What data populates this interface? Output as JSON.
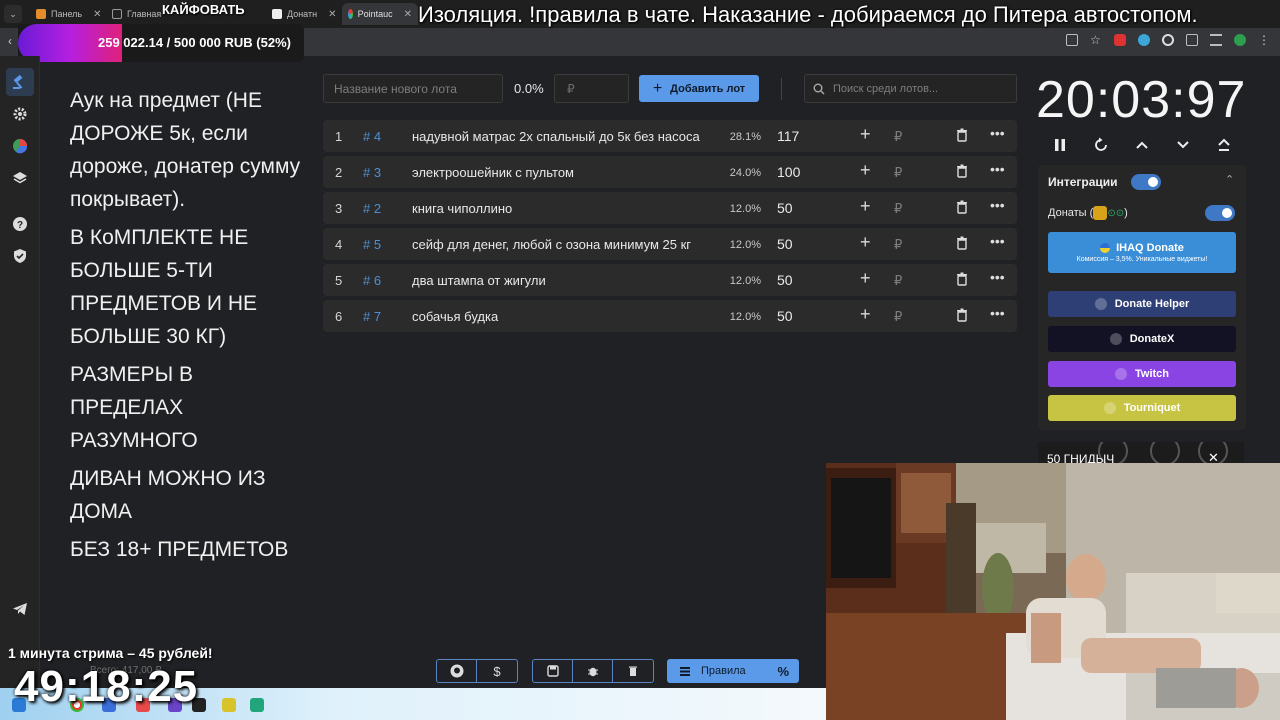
{
  "browser": {
    "tabs": [
      {
        "label": "Панель"
      },
      {
        "label": "Главная"
      },
      {
        "label": "Донатн"
      },
      {
        "label": "Pointauc"
      }
    ]
  },
  "overlay": {
    "stream_title": "Изоляция. !правила в чате. Наказание - добираемся до Питера автостопом.",
    "kaifovat": "КАЙФОВАТЬ",
    "donation_progress_text": "259 022.14 / 500 000 RUB (52%)",
    "donation_progress": 0.52,
    "stream_price_note": "1 минута стрима – 45 рублей!",
    "big_clock": "49:18:25",
    "total_faded": "Всего: 417,00 ₽"
  },
  "rules": [
    "Аук на предмет (НЕ ДОРОЖЕ 5к, если дороже, донатер сумму покрывает).",
    "В КоМПЛЕКТЕ НЕ БОЛЬШЕ 5-ТИ ПРЕДМЕТОВ И НЕ БОЛЬШЕ 30 КГ)",
    "РАЗМЕРЫ В ПРЕДЕЛАХ РАЗУМНОГО",
    "ДИВАН МОЖНО ИЗ ДОМА",
    "БЕЗ 18+ ПРЕДМЕТОВ"
  ],
  "lot_form": {
    "name_placeholder": "Название нового лота",
    "percent": "0.0%",
    "amount_placeholder": "₽",
    "add_label": "Добавить лот",
    "search_placeholder": "Поиск среди лотов..."
  },
  "lots": [
    {
      "n": "1",
      "id": "# 4",
      "name": "надувной матрас 2х спальный до 5к без насоса",
      "pct": "28.1%",
      "amount": "117",
      "rub": "₽"
    },
    {
      "n": "2",
      "id": "# 3",
      "name": "электроошейник с пультом",
      "pct": "24.0%",
      "amount": "100",
      "rub": "₽"
    },
    {
      "n": "3",
      "id": "# 2",
      "name": "книга чиполлино",
      "pct": "12.0%",
      "amount": "50",
      "rub": "₽"
    },
    {
      "n": "4",
      "id": "# 5",
      "name": "сейф для денег, любой с озона минимум 25 кг",
      "pct": "12.0%",
      "amount": "50",
      "rub": "₽"
    },
    {
      "n": "5",
      "id": "# 6",
      "name": "два штампа от жигули",
      "pct": "12.0%",
      "amount": "50",
      "rub": "₽"
    },
    {
      "n": "6",
      "id": "# 7",
      "name": "собачья будка",
      "pct": "12.0%",
      "amount": "50",
      "rub": "₽"
    }
  ],
  "timer": {
    "value": "20:03:97"
  },
  "integrations": {
    "title": "Интеграции",
    "donats_label": "Донаты (",
    "donats_close": ")",
    "iq_label": "IHAQ Donate",
    "iq_sub": "Комиссия – 3,5%. Уникальные виджеты!",
    "buttons": [
      {
        "label": "Donate Helper",
        "color": "#2d3f75"
      },
      {
        "label": "DonateX",
        "color": "#121224"
      },
      {
        "label": "Twitch",
        "color": "#8a44e4"
      },
      {
        "label": "Tourniquet",
        "color": "#c7c444"
      }
    ]
  },
  "pic_strip_text": "50 ГНИДЫЧ",
  "footer": {
    "rules_label": "Правила",
    "percent_sign": "%"
  }
}
